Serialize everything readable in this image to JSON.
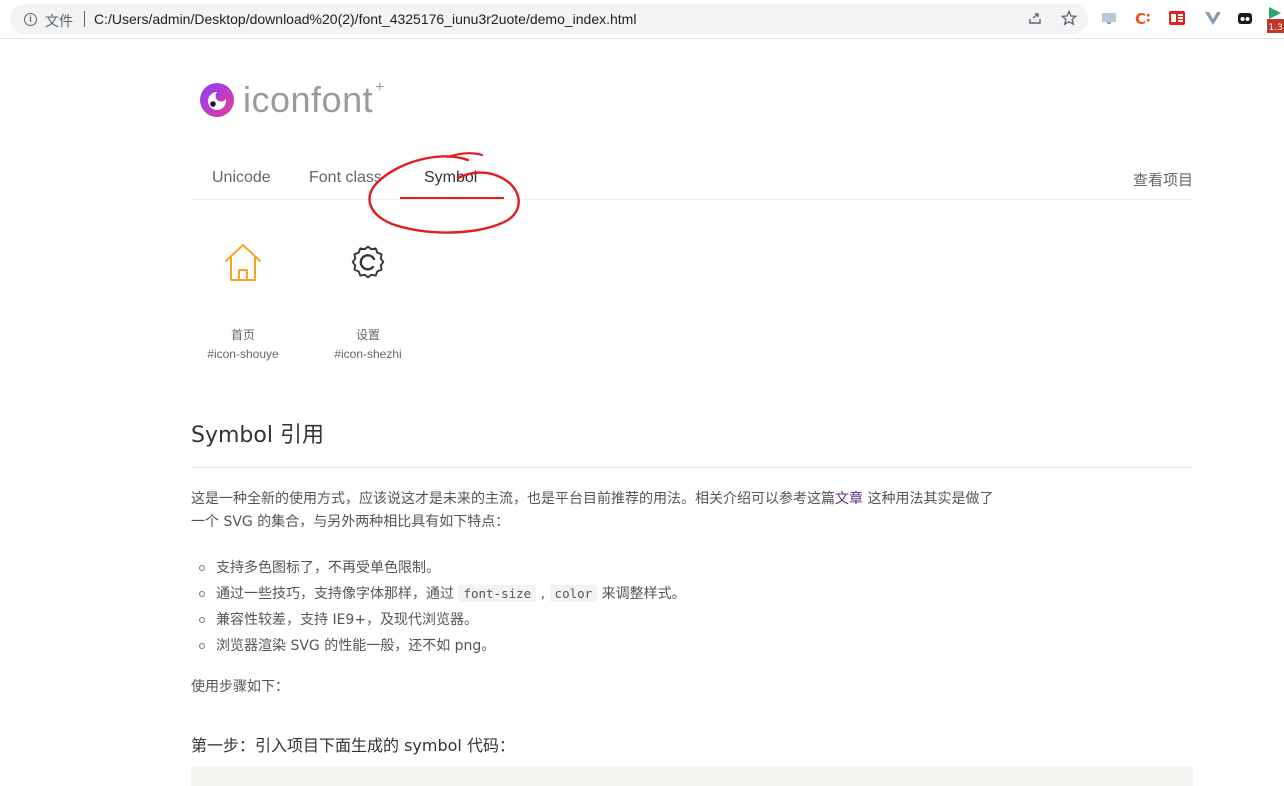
{
  "browser": {
    "scheme_label": "文件",
    "url": "C:/Users/admin/Desktop/download%20(2)/font_4325176_iunu3r2uote/demo_index.html",
    "extension_badge": "1.3"
  },
  "logo": {
    "text": "iconfont",
    "plus": "+"
  },
  "tabs": {
    "unicode": "Unicode",
    "font_class": "Font class",
    "symbol": "Symbol",
    "view_project": "查看项目"
  },
  "icons": [
    {
      "name": "首页",
      "code": "#icon-shouye",
      "icon": "home-icon",
      "color": "#f5a623"
    },
    {
      "name": "设置",
      "code": "#icon-shezhi",
      "icon": "gear-icon",
      "color": "#333333"
    }
  ],
  "section": {
    "title": "Symbol 引用",
    "intro_before_link": "这是一种全新的使用方式，应该说这才是未来的主流，也是平台目前推荐的用法。相关介绍可以参考这篇",
    "intro_link": "文章",
    "intro_after_link": " 这种用法其实是做了一个 SVG 的集合，与另外两种相比具有如下特点：",
    "features": {
      "f1": "支持多色图标了，不再受单色限制。",
      "f2_before": "通过一些技巧，支持像字体那样，通过 ",
      "f2_code1": "font-size",
      "f2_sep": " , ",
      "f2_code2": "color",
      "f2_after": " 来调整样式。",
      "f3": "兼容性较差，支持 IE9+，及现代浏览器。",
      "f4": "浏览器渲染 SVG 的性能一般，还不如 png。"
    },
    "steps_label": "使用步骤如下：",
    "step_one": "第一步：引入项目下面生成的 symbol 代码："
  },
  "colors": {
    "active_tab_underline": "#e2231a",
    "annotation_red": "#e01e1e",
    "link_purple": "#5b2b86"
  }
}
